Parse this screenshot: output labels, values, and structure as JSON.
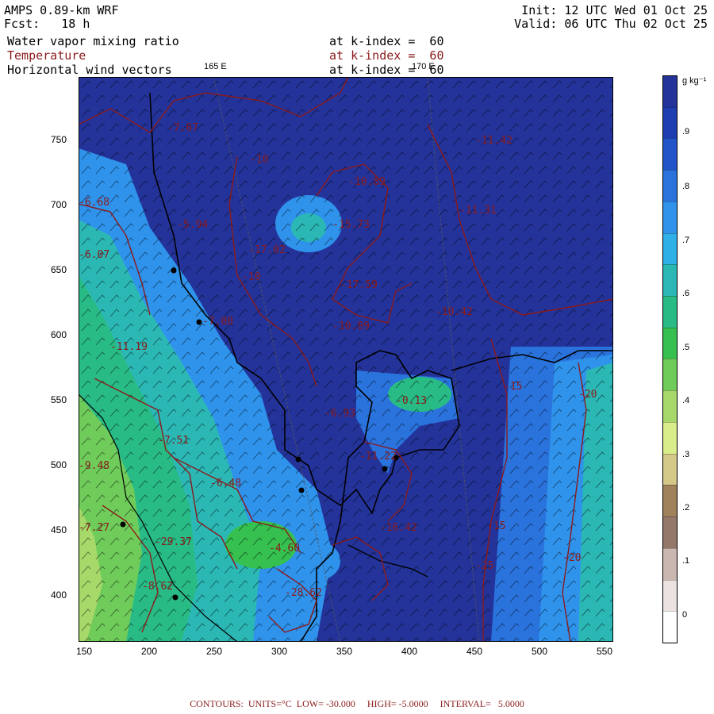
{
  "header": {
    "model": "AMPS 0.89-km WRF",
    "forecast": "Fcst:   18 h",
    "init": "Init: 12 UTC Wed 01 Oct 25",
    "valid": "Valid: 06 UTC Thu 02 Oct 25",
    "fields": [
      {
        "name": "Water vapor mixing ratio",
        "level": "at k-index =  60",
        "color": "#000000"
      },
      {
        "name": "Temperature",
        "level": "at k-index =  60",
        "color": "#8b1a1a"
      },
      {
        "name": "Horizontal wind vectors",
        "level": "at k-index =  60",
        "color": "#000000"
      }
    ]
  },
  "longitude_labels": [
    "165 E",
    "170 E"
  ],
  "x_axis_ticks": [
    "150",
    "200",
    "250",
    "300",
    "350",
    "400",
    "450",
    "500",
    "550"
  ],
  "y_axis_ticks": [
    "750",
    "700",
    "650",
    "600",
    "550",
    "500",
    "450",
    "400"
  ],
  "colorbar": {
    "unit": "g kg⁻¹",
    "labels": [
      ".9",
      ".8",
      ".7",
      ".6",
      ".5",
      ".4",
      ".3",
      ".2",
      ".1",
      "0"
    ],
    "colors": [
      "#24339a",
      "#1f3fb0",
      "#2355c8",
      "#2a73dd",
      "#2f93ec",
      "#2fb0e6",
      "#2bb8b5",
      "#29bb86",
      "#35c04f",
      "#6fcc5a",
      "#a6d96a",
      "#d9ee8a",
      "#d5c98a",
      "#a0825c",
      "#94786a",
      "#c9b7b0",
      "#ece3e1",
      "#ffffff"
    ]
  },
  "contour_labels": [
    {
      "text": "-7.67"
    },
    {
      "text": "-10"
    },
    {
      "text": "-10.89"
    },
    {
      "text": "-15.73"
    },
    {
      "text": "-17.02"
    },
    {
      "text": "-10"
    },
    {
      "text": "-17.59"
    },
    {
      "text": "-10.89"
    },
    {
      "text": "-10.42"
    },
    {
      "text": "-11.42"
    },
    {
      "text": "-11.31"
    },
    {
      "text": "-5.94"
    },
    {
      "text": "-7.08"
    },
    {
      "text": "-11.19"
    },
    {
      "text": "-6.93"
    },
    {
      "text": "-7.51"
    },
    {
      "text": "-6.48"
    },
    {
      "text": "-9.48"
    },
    {
      "text": "-29.37"
    },
    {
      "text": "-4.60"
    },
    {
      "text": "-28.62"
    },
    {
      "text": "-11.22"
    },
    {
      "text": "-16.42"
    },
    {
      "text": "-15"
    },
    {
      "text": "-20"
    },
    {
      "text": "-25"
    },
    {
      "text": "-20"
    },
    {
      "text": "-15"
    },
    {
      "text": "-6.68"
    },
    {
      "text": "-7.27"
    },
    {
      "text": "-8.62"
    },
    {
      "text": "-0.13"
    },
    {
      "text": "-6.07"
    }
  ],
  "footer": "CONTOURS:  UNITS=°C  LOW= -30.000     HIGH= -5.0000     INTERVAL=   5.0000"
}
